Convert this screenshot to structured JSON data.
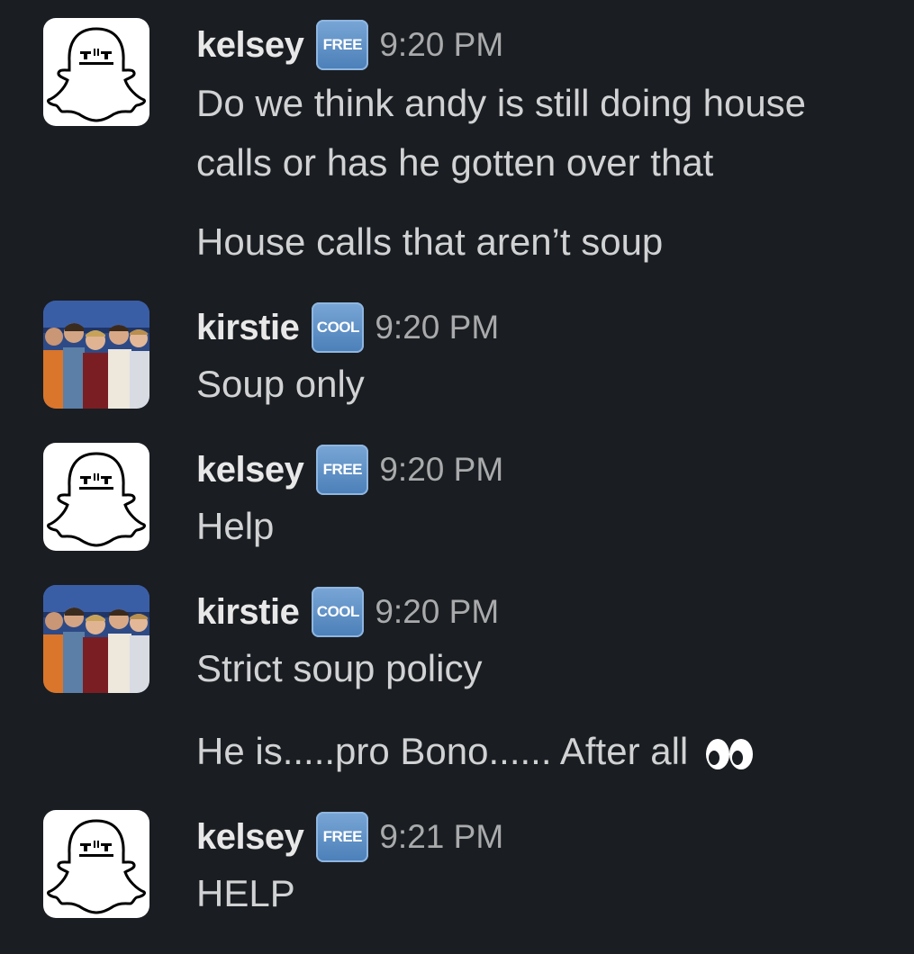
{
  "messages": [
    {
      "username": "kelsey",
      "badge": "FREE",
      "time": "9:20 PM",
      "avatar": "snapchat-ghost-icon",
      "lines": [
        "Do we think andy is still doing house",
        "calls or has he gotten over that",
        "House calls that aren’t soup"
      ]
    },
    {
      "username": "kirstie",
      "badge": "COOL",
      "time": "9:20 PM",
      "avatar": "group-photo",
      "lines": [
        "Soup only"
      ]
    },
    {
      "username": "kelsey",
      "badge": "FREE",
      "time": "9:20 PM",
      "avatar": "snapchat-ghost-icon",
      "lines": [
        "Help"
      ]
    },
    {
      "username": "kirstie",
      "badge": "COOL",
      "time": "9:20 PM",
      "avatar": "group-photo",
      "lines": [
        "Strict soup policy",
        "He is.....pro Bono...... After all"
      ],
      "trailing_emoji": "eyes-emoji"
    },
    {
      "username": "kelsey",
      "badge": "FREE",
      "time": "9:21 PM",
      "avatar": "snapchat-ghost-icon",
      "lines": [
        "HELP"
      ]
    }
  ],
  "colors": {
    "background": "#1a1d21",
    "text": "#d1d2d3",
    "username": "#e8e8e8",
    "timestamp": "#a9aaab",
    "badge": "#5f93c9"
  }
}
